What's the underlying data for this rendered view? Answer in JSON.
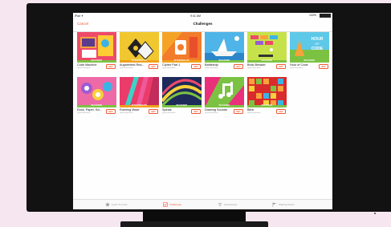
{
  "status_bar": {
    "left": "iPad ✦",
    "time": "9:41 AM",
    "right": "100%"
  },
  "nav": {
    "cancel_label": "Cancel",
    "title": "Challenges"
  },
  "challenges": [
    {
      "title": "Code Machine",
      "subtitle": "Apple Education",
      "level": "BEGINNER",
      "level_color": "#7cc242",
      "get": "GET"
    },
    {
      "title": "Augmented Rea...",
      "subtitle": "Apple Education",
      "level": "INTERMEDIATE",
      "level_color": "#f0a11b",
      "get": "GET"
    },
    {
      "title": "Cipher Part 1",
      "subtitle": "Apple Education",
      "level": "INTERMEDIATE",
      "level_color": "#f0a11b",
      "get": "GET"
    },
    {
      "title": "Battleship",
      "subtitle": "Apple Education",
      "level": "BEGINNER",
      "level_color": "#7cc242",
      "get": "GET"
    },
    {
      "title": "Brick Breaker",
      "subtitle": "Apple Education",
      "level": "BEGINNER",
      "level_color": "#7cc242",
      "get": "GET"
    },
    {
      "title": "Hour of Code",
      "subtitle": "Apple Education",
      "level": "BEGINNER",
      "level_color": "#7cc242",
      "get": "GET"
    },
    {
      "title": "Rock, Paper, Sci...",
      "subtitle": "Apple Education",
      "level": "BEGINNER",
      "level_color": "#7cc242",
      "get": "GET"
    },
    {
      "title": "Running Maze",
      "subtitle": "Apple Education",
      "level": "INTERMEDIATE",
      "level_color": "#f0a11b",
      "get": "GET"
    },
    {
      "title": "Spirals",
      "subtitle": "Apple Education",
      "level": "BEGINNER",
      "level_color": "#7cc242",
      "get": "GET"
    },
    {
      "title": "Drawing Sounds",
      "subtitle": "Apple Education",
      "level": "BEGINNER",
      "level_color": "#7cc242",
      "get": "GET"
    },
    {
      "title": "Blink",
      "subtitle": "Apple Education",
      "level": "BEGINNER",
      "level_color": "#7cc242",
      "get": "GET"
    }
  ],
  "thumb_text": {
    "hour": "HOUR",
    "of": "OF",
    "code": "CODE"
  },
  "tabs": [
    {
      "label": "Learn To Code",
      "icon": "star-icon",
      "active": false
    },
    {
      "label": "Challenges",
      "icon": "checkbox-icon",
      "active": true
    },
    {
      "label": "Accessories",
      "icon": "antenna-icon",
      "active": false
    },
    {
      "label": "Starting Points",
      "icon": "flag-icon",
      "active": false
    }
  ],
  "colors": {
    "accent": "#f05a32",
    "beginner": "#7cc242",
    "intermediate": "#f0a11b"
  }
}
